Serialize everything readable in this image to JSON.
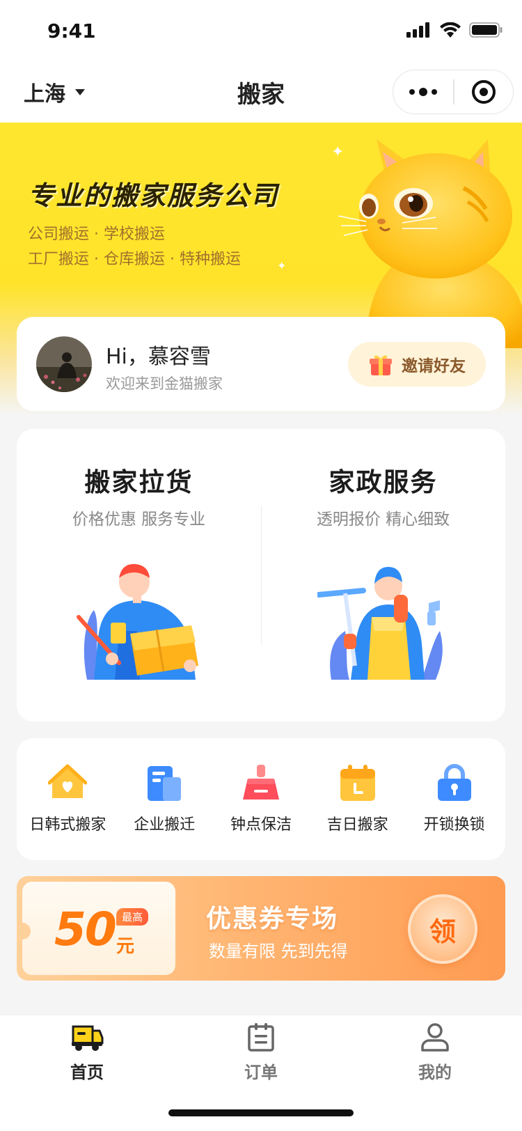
{
  "status_bar": {
    "time": "9:41",
    "icons": [
      "signal-icon",
      "wifi-icon",
      "battery-icon"
    ]
  },
  "nav": {
    "city": "上海",
    "title": "搬家"
  },
  "banner": {
    "title": "专业的搬家服务公司",
    "line1": "公司搬运 · 学校搬运",
    "line2": "工厂搬运 · 仓库搬运 · 特种搬运"
  },
  "user": {
    "greeting": "Hi，慕容雪",
    "welcome": "欢迎来到金猫搬家",
    "invite_label": "邀请好友"
  },
  "services": [
    {
      "title": "搬家拉货",
      "subtitle": "价格优惠 服务专业"
    },
    {
      "title": "家政服务",
      "subtitle": "透明报价 精心细致"
    }
  ],
  "quick_menu": [
    {
      "label": "日韩式搬家",
      "icon": "house-icon"
    },
    {
      "label": "企业搬迁",
      "icon": "building-icon"
    },
    {
      "label": "钟点保洁",
      "icon": "broom-icon"
    },
    {
      "label": "吉日搬家",
      "icon": "calendar-icon"
    },
    {
      "label": "开锁换锁",
      "icon": "lock-icon"
    }
  ],
  "coupon": {
    "amount": "50",
    "badge": "最高",
    "unit": "元",
    "title": "优惠券专场",
    "subtitle": "数量有限 先到先得",
    "button": "领"
  },
  "tabbar": [
    {
      "label": "首页",
      "icon": "truck-icon",
      "active": true
    },
    {
      "label": "订单",
      "icon": "clipboard-icon",
      "active": false
    },
    {
      "label": "我的",
      "icon": "user-icon",
      "active": false
    }
  ],
  "colors": {
    "brand_yellow": "#ffe62f",
    "accent_orange": "#ff7a0f",
    "quick_blue": "#3d8bff"
  }
}
